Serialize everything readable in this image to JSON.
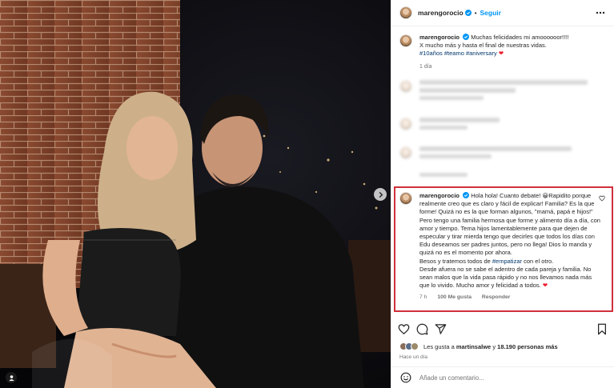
{
  "post": {
    "username": "marengorocio",
    "follow_label": "Seguir",
    "separator": "•",
    "more_icon": "more-horizontal-icon"
  },
  "caption": {
    "username": "marengorocio",
    "text_1": "Muchas felicidades mi amoooooor!!!!",
    "text_2": "X mucho más y hasta el final de nuestras vidas.",
    "hashtags": "#10años #teamo #aniversary",
    "heart": "❤",
    "time": "1 día"
  },
  "highlighted_comment": {
    "username": "marengorocio",
    "text_before_tag": "Hola hola! Cuanto debate! 😀Rapidito porque realmente creo que es claro y fácil de explicar! Familia? Es la que forme! Quizá no es la que forman algunos, \"mamá, papá e hijos!\" Pero tengo una familia hermosa que forme y alimento día a día, con amor y tiempo. Tema hijos lamentablemente para que dejen de especular y tirar mierda tengo que decirles que todos los días con Edu deseamos ser padres juntos, pero no llega! Dios lo manda y quizá no es el momento por ahora.",
    "text_tag_prefix": "Besos y tratemos todos de",
    "tag": "#empatizar",
    "text_tag_suffix": "con el otro.",
    "text_after": "Desde afuera no se sabe el adentro de cada pareja y familia. No sean malos que la vida pasa rápido y no nos llevamos nada más que lo vivido. Mucho amor y felicidad a todos.",
    "heart": "❤",
    "time": "7 h",
    "likes": "100 Me gusta",
    "reply": "Responder"
  },
  "likes_line": {
    "prefix": "Les gusta a",
    "user": "martinsalwe",
    "middle": "y",
    "count": "18.190 personas más"
  },
  "posted_ago": "Hace un día",
  "add_comment": {
    "placeholder": "Añade un comentario..."
  },
  "colors": {
    "accent": "#0095f6",
    "highlight_border": "#d0303c",
    "heart": "#ed1c2e",
    "hashtag": "#00376b"
  }
}
